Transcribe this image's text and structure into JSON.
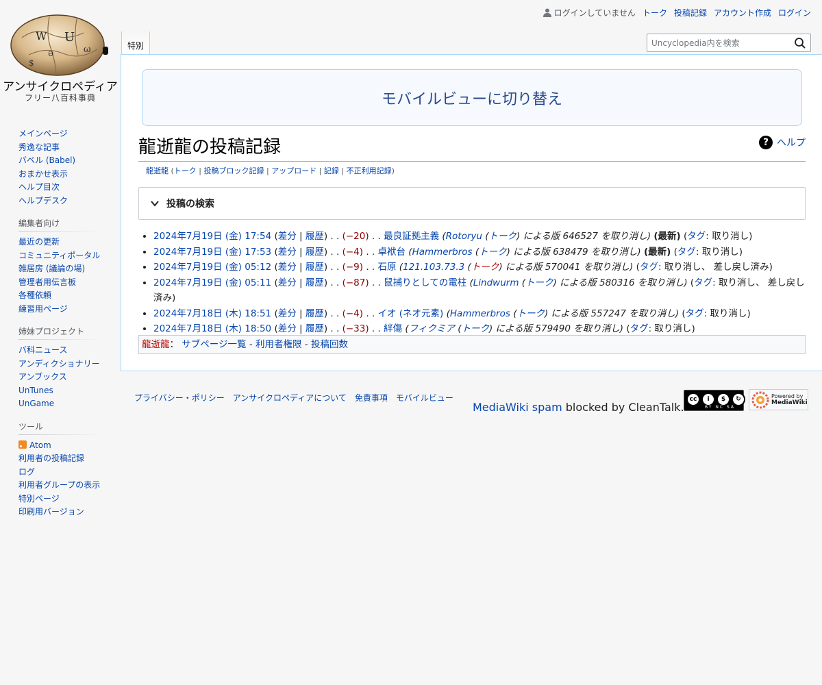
{
  "site": {
    "wordmark": "アンサイクロペディア",
    "tagline": "フリー八百科事典"
  },
  "personal": {
    "not_logged_in": "ログインしていません",
    "talk": "トーク",
    "contributions": "投稿記録",
    "create_account": "アカウント作成",
    "login": "ログイン"
  },
  "tabs": {
    "special": "特別"
  },
  "search": {
    "placeholder": "Uncyclopedia内を検索"
  },
  "sidebar": {
    "navigation": [
      "メインページ",
      "秀逸な記事",
      "バベル (Babel)",
      "おまかせ表示",
      "ヘルプ目次",
      "ヘルプデスク"
    ],
    "editors_heading": "編集者向け",
    "editors": [
      "最近の更新",
      "コミュニティポータル",
      "雑居房 (議論の場)",
      "管理者用伝言板",
      "各種依頼",
      "練習用ページ"
    ],
    "sister_heading": "姉妹プロジェクト",
    "sister": [
      "バ科ニュース",
      "アンディクショナリー",
      "アンブックス",
      "UnTunes",
      "UnGame"
    ],
    "tools_heading": "ツール",
    "tools": [
      "Atom",
      "利用者の投稿記録",
      "ログ",
      "利用者グループの表示",
      "特別ページ",
      "印刷用バージョン"
    ]
  },
  "content": {
    "mobile_banner": "モバイルビューに切り替え",
    "heading": "龍逝龍の投稿記録",
    "help": "ヘルプ",
    "subtitle": {
      "user": "龍逝龍",
      "open": "(",
      "talk": "トーク",
      "block_log": "投稿ブロック記録",
      "upload": "アップロード",
      "logs": "記録",
      "abuse_log": "不正利用記録",
      "close": ")"
    },
    "search_form_title": "投稿の検索",
    "entries": [
      {
        "date": "2024年7月19日 (金) 17:54",
        "diff_label": "差分",
        "hist_label": "履歴",
        "size": "(−20)",
        "page": "最良証拠主義",
        "undo_user": "Rotoryu",
        "undo_talk": "トーク",
        "undo_text": "による版 646527 を取り消し",
        "newest": "(最新)",
        "tag_label": "タグ",
        "tags": ": 取り消し"
      },
      {
        "date": "2024年7月19日 (金) 17:53",
        "diff_label": "差分",
        "hist_label": "履歴",
        "size": "(−4)",
        "page": "卓袱台",
        "undo_user": "Hammerbros",
        "undo_talk": "トーク",
        "undo_text": "による版 638479 を取り消し",
        "newest": "(最新)",
        "tag_label": "タグ",
        "tags": ": 取り消し"
      },
      {
        "date": "2024年7月19日 (金) 05:12",
        "diff_label": "差分",
        "hist_label": "履歴",
        "size": "(−9)",
        "page": "石原",
        "undo_user": "121.103.73.3",
        "undo_talk": "トーク",
        "undo_text": "による版 570041 を取り消し",
        "newest": "",
        "tag_label": "タグ",
        "tags": ": 取り消し、 差し戻し済み"
      },
      {
        "date": "2024年7月19日 (金) 05:11",
        "diff_label": "差分",
        "hist_label": "履歴",
        "size": "(−87)",
        "page": "鼠捕りとしての電柱",
        "undo_user": "Lindwurm",
        "undo_talk": "トーク",
        "undo_text": "による版 580316 を取り消し",
        "newest": "",
        "tag_label": "タグ",
        "tags": ": 取り消し、 差し戻し済み"
      },
      {
        "date": "2024年7月18日 (木) 18:51",
        "diff_label": "差分",
        "hist_label": "履歴",
        "size": "(−4)",
        "page": "イオ (ネオ元素)",
        "undo_user": "Hammerbros",
        "undo_talk": "トーク",
        "undo_text": "による版 557247 を取り消し",
        "newest": "",
        "tag_label": "タグ",
        "tags": ": 取り消し"
      },
      {
        "date": "2024年7月18日 (木) 18:50",
        "diff_label": "差分",
        "hist_label": "履歴",
        "size": "(−33)",
        "page": "絆傷",
        "undo_user": "フィクミア",
        "undo_talk": "トーク",
        "undo_text": "による版 579490 を取り消し",
        "newest": "",
        "tag_label": "タグ",
        "tags": ": 取り消し"
      }
    ],
    "toollinks": {
      "user": "龍逝龍",
      "colon": "：",
      "subpages": "サブページ一覧",
      "rights": "利用者権限",
      "editcount": "投稿回数"
    }
  },
  "footer": {
    "privacy": "プライバシー・ポリシー",
    "about": "アンサイクロペディアについて",
    "disclaimer": "免責事項",
    "mobile": "モバイルビュー",
    "spam_link": "MediaWiki spam",
    "spam_text": "blocked by CleanTalk.",
    "cc_label": "BY NC SA",
    "powered_by": "Powered by",
    "mediawiki": "MediaWiki"
  }
}
